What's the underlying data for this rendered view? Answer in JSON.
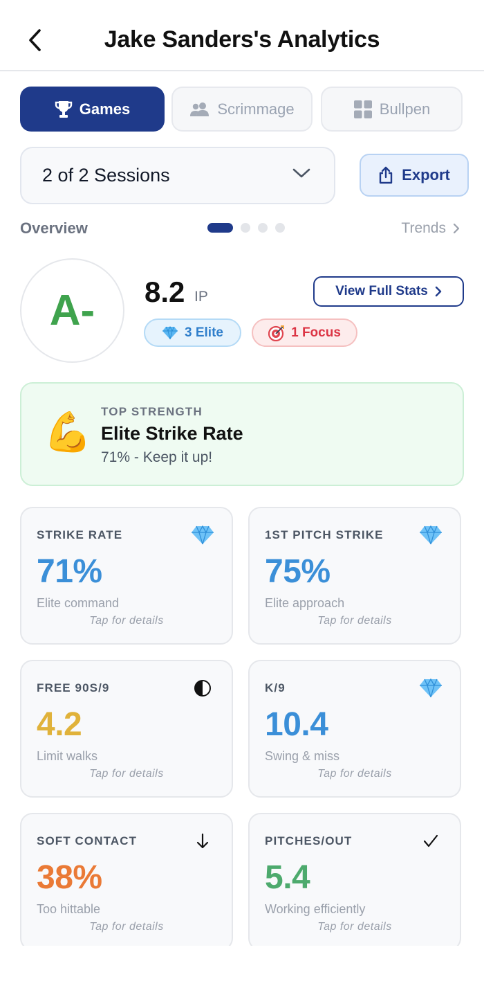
{
  "header": {
    "title": "Jake Sanders's Analytics",
    "back_icon": "chevron-left-icon"
  },
  "tabs": [
    {
      "label": "Games",
      "icon": "trophy-icon",
      "active": true
    },
    {
      "label": "Scrimmage",
      "icon": "users-icon",
      "active": false
    },
    {
      "label": "Bullpen",
      "icon": "grid-icon",
      "active": false
    }
  ],
  "session_selector": {
    "value": "2 of 2 Sessions",
    "icon": "chevron-down-icon"
  },
  "export": {
    "label": "Export",
    "icon": "share-icon"
  },
  "overview": {
    "label": "Overview",
    "trends_label": "Trends",
    "page_count": 4,
    "active_page": 1
  },
  "summary": {
    "grade": "A-",
    "innings": "8.2",
    "innings_unit": "IP",
    "full_stats_label": "View Full Stats",
    "elite_badge": "3 Elite",
    "focus_badge": "1 Focus"
  },
  "top_strength": {
    "label": "TOP STRENGTH",
    "title": "Elite Strike Rate",
    "subtitle": "71% - Keep it up!",
    "icon": "flexed-biceps-icon"
  },
  "stats": [
    {
      "label": "STRIKE RATE",
      "value": "71%",
      "note": "Elite command",
      "tap": "Tap for details",
      "icon": "diamond-icon",
      "color": "#3b8fd8"
    },
    {
      "label": "1ST PITCH STRIKE",
      "value": "75%",
      "note": "Elite approach",
      "tap": "Tap for details",
      "icon": "diamond-icon",
      "color": "#3b8fd8"
    },
    {
      "label": "FREE 90S/9",
      "value": "4.2",
      "note": "Limit walks",
      "tap": "Tap for details",
      "icon": "half-circle-icon",
      "color": "#e0b23a"
    },
    {
      "label": "K/9",
      "value": "10.4",
      "note": "Swing & miss",
      "tap": "Tap for details",
      "icon": "diamond-icon",
      "color": "#3b8fd8"
    },
    {
      "label": "SOFT CONTACT",
      "value": "38%",
      "note": "Too hittable",
      "tap": "Tap for details",
      "icon": "arrow-down-icon",
      "color": "#ea7a36"
    },
    {
      "label": "PITCHES/OUT",
      "value": "5.4",
      "note": "Working efficiently",
      "tap": "Tap for details",
      "icon": "checkmark-icon",
      "color": "#4daa6d"
    }
  ],
  "colors": {
    "primary": "#1f3a8a",
    "grade": "#3fa34d",
    "elite": "#2f7ecb",
    "focus": "#dc3545"
  }
}
